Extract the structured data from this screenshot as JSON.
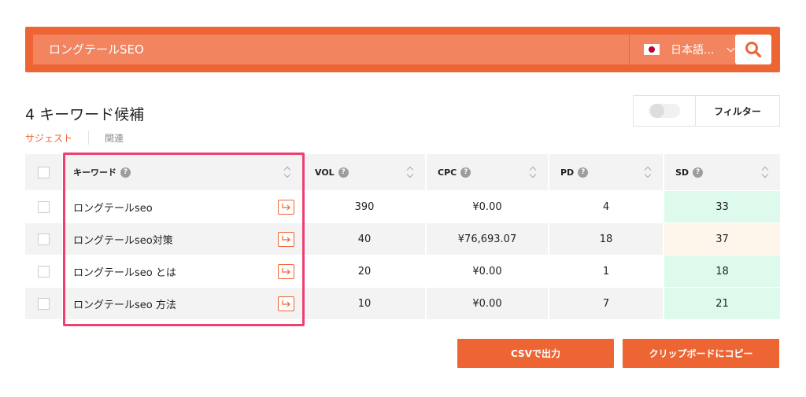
{
  "search": {
    "query": "ロングテールSEO",
    "language": "日本語..."
  },
  "result_title": "4 キーワード候補",
  "tabs": {
    "suggest": "サジェスト",
    "related": "関連"
  },
  "filter_label": "フィルター",
  "table": {
    "headers": {
      "keyword": "キーワード",
      "vol": "VOL",
      "cpc": "CPC",
      "pd": "PD",
      "sd": "SD"
    },
    "rows": [
      {
        "keyword": "ロングテールseo",
        "vol": "390",
        "cpc": "¥0.00",
        "pd": "4",
        "sd": "33"
      },
      {
        "keyword": "ロングテールseo対策",
        "vol": "40",
        "cpc": "¥76,693.07",
        "pd": "18",
        "sd": "37"
      },
      {
        "keyword": "ロングテールseo とは",
        "vol": "20",
        "cpc": "¥0.00",
        "pd": "1",
        "sd": "18"
      },
      {
        "keyword": "ロングテールseo 方法",
        "vol": "10",
        "cpc": "¥0.00",
        "pd": "7",
        "sd": "21"
      }
    ]
  },
  "buttons": {
    "csv": "CSVで出力",
    "copy": "クリップボードにコピー"
  },
  "colors": {
    "accent": "#ee6534",
    "highlight": "#ee3f71",
    "sd_easy": "#ddfaec",
    "sd_medium": "#fef6ea"
  }
}
